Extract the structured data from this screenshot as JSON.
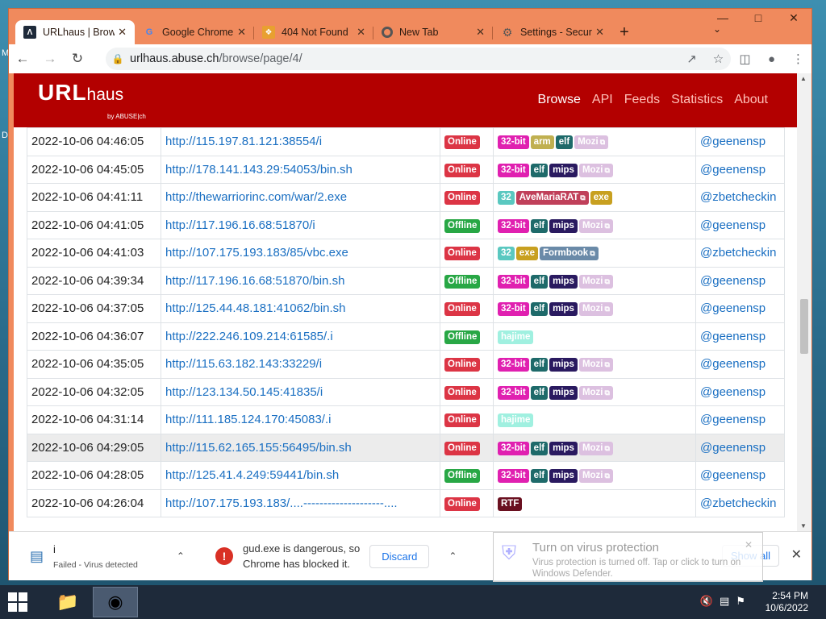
{
  "tabs": [
    {
      "label": "URLhaus | Browse",
      "icon": "urlhaus-icon",
      "active": true
    },
    {
      "label": "Google Chrome",
      "icon": "google-icon"
    },
    {
      "label": "404 Not Found",
      "icon": "bracket-icon"
    },
    {
      "label": "New Tab",
      "icon": "chrome-icon"
    },
    {
      "label": "Settings - Security",
      "icon": "gear-icon"
    }
  ],
  "toolbar": {
    "url_host": "urlhaus.abuse.ch",
    "url_path": "/browse/page/4/"
  },
  "site": {
    "logo_main": "URL",
    "logo_sub": "haus",
    "logo_by": "by ABUSE|ch",
    "nav": [
      "Browse",
      "API",
      "Feeds",
      "Statistics",
      "About"
    ]
  },
  "rows": [
    {
      "date": "2022-10-06 04:46:05",
      "url": "http://115.197.81.121:38554/i",
      "status": "Online",
      "tags": [
        "32-bit",
        "arm",
        "elf",
        "Mozi"
      ],
      "reporter": "@geenensp"
    },
    {
      "date": "2022-10-06 04:45:05",
      "url": "http://178.141.143.29:54053/bin.sh",
      "status": "Online",
      "tags": [
        "32-bit",
        "elf",
        "mips",
        "Mozi"
      ],
      "reporter": "@geenensp"
    },
    {
      "date": "2022-10-06 04:41:11",
      "url": "http://thewarriorinc.com/war/2.exe",
      "status": "Online",
      "tags": [
        "32",
        "AveMariaRAT",
        "exe"
      ],
      "reporter": "@zbetcheckin"
    },
    {
      "date": "2022-10-06 04:41:05",
      "url": "http://117.196.16.68:51870/i",
      "status": "Offline",
      "tags": [
        "32-bit",
        "elf",
        "mips",
        "Mozi"
      ],
      "reporter": "@geenensp"
    },
    {
      "date": "2022-10-06 04:41:03",
      "url": "http://107.175.193.183/85/vbc.exe",
      "status": "Online",
      "tags": [
        "32",
        "exe",
        "Formbook"
      ],
      "reporter": "@zbetcheckin"
    },
    {
      "date": "2022-10-06 04:39:34",
      "url": "http://117.196.16.68:51870/bin.sh",
      "status": "Offline",
      "tags": [
        "32-bit",
        "elf",
        "mips",
        "Mozi"
      ],
      "reporter": "@geenensp"
    },
    {
      "date": "2022-10-06 04:37:05",
      "url": "http://125.44.48.181:41062/bin.sh",
      "status": "Online",
      "tags": [
        "32-bit",
        "elf",
        "mips",
        "Mozi"
      ],
      "reporter": "@geenensp"
    },
    {
      "date": "2022-10-06 04:36:07",
      "url": "http://222.246.109.214:61585/.i",
      "status": "Offline",
      "tags": [
        "hajime"
      ],
      "reporter": "@geenensp"
    },
    {
      "date": "2022-10-06 04:35:05",
      "url": "http://115.63.182.143:33229/i",
      "status": "Online",
      "tags": [
        "32-bit",
        "elf",
        "mips",
        "Mozi"
      ],
      "reporter": "@geenensp"
    },
    {
      "date": "2022-10-06 04:32:05",
      "url": "http://123.134.50.145:41835/i",
      "status": "Online",
      "tags": [
        "32-bit",
        "elf",
        "mips",
        "Mozi"
      ],
      "reporter": "@geenensp"
    },
    {
      "date": "2022-10-06 04:31:14",
      "url": "http://111.185.124.170:45083/.i",
      "status": "Online",
      "tags": [
        "hajime"
      ],
      "reporter": "@geenensp"
    },
    {
      "date": "2022-10-06 04:29:05",
      "url": "http://115.62.165.155:56495/bin.sh",
      "status": "Online",
      "tags": [
        "32-bit",
        "elf",
        "mips",
        "Mozi"
      ],
      "reporter": "@geenensp",
      "highlight": true
    },
    {
      "date": "2022-10-06 04:28:05",
      "url": "http://125.41.4.249:59441/bin.sh",
      "status": "Offline",
      "tags": [
        "32-bit",
        "elf",
        "mips",
        "Mozi"
      ],
      "reporter": "@geenensp"
    },
    {
      "date": "2022-10-06 04:26:04",
      "url": "http://107.175.193.183/....--------------------....",
      "status": "Online",
      "tags": [
        "RTF"
      ],
      "reporter": "@zbetcheckin"
    }
  ],
  "tag_colors": {
    "32-bit": "#e020b0",
    "arm": "#c0b050",
    "elf": "#1e6a6a",
    "mips": "#2a1a60",
    "Mozi": "#dcc0e0",
    "32": "#5ac8c0",
    "AveMariaRAT": "#c0405a",
    "exe": "#c8a020",
    "Formbook": "#6a8aa8",
    "hajime": "#a0f0e0",
    "RTF": "#6a1020"
  },
  "tag_links": [
    "Mozi",
    "AveMariaRAT",
    "Formbook"
  ],
  "downloads": {
    "item1_name": "i",
    "item1_status": "Failed - Virus detected",
    "warning_line1": "gud.exe is dangerous, so",
    "warning_line2": "Chrome has blocked it.",
    "discard_label": "Discard",
    "show_all_label": "Show all"
  },
  "toast": {
    "title": "Turn on virus protection",
    "body": "Virus protection is turned off. Tap or click to turn on Windows Defender."
  },
  "taskbar": {
    "time": "2:54 PM",
    "date": "10/6/2022"
  },
  "desktop": {
    "glyph1": "M",
    "glyph2": "D"
  }
}
